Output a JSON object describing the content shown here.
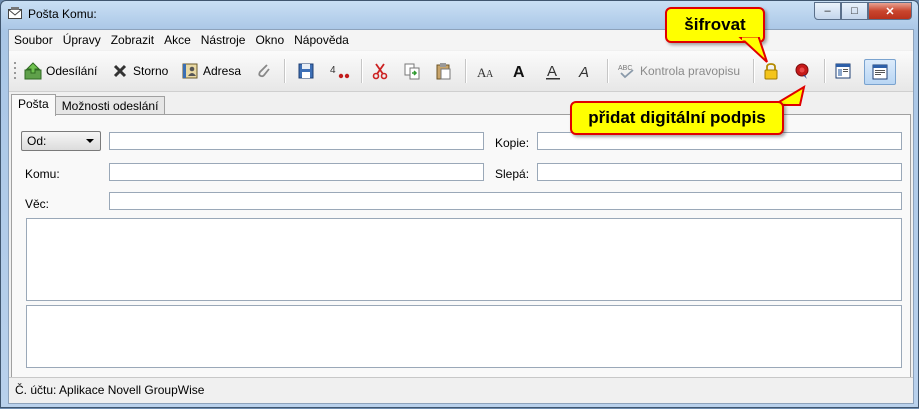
{
  "window": {
    "title": "Pošta Komu:"
  },
  "menu": [
    "Soubor",
    "Úpravy",
    "Zobrazit",
    "Akce",
    "Nástroje",
    "Okno",
    "Nápověda"
  ],
  "toolbar": {
    "send_label": "Odesílání",
    "cancel_label": "Storno",
    "address_label": "Adresa",
    "spellcheck_label": "Kontrola pravopisu"
  },
  "tabs": [
    "Pošta",
    "Možnosti odeslání"
  ],
  "form": {
    "from_selected": "Od:",
    "from_value": "",
    "to_label": "Komu:",
    "to_value": "",
    "subject_label": "Věc:",
    "subject_value": "",
    "cc_label": "Kopie:",
    "cc_value": "",
    "bcc_label": "Slepá:",
    "bcc_value": ""
  },
  "status": {
    "text": "Č. účtu: Aplikace Novell GroupWise"
  },
  "callouts": {
    "encrypt": "šifrovat",
    "sign": "přidat digitální podpis"
  },
  "colors": {
    "callout_bg": "#ffff00",
    "callout_border": "#e00000",
    "accent": "#3a78c3"
  }
}
